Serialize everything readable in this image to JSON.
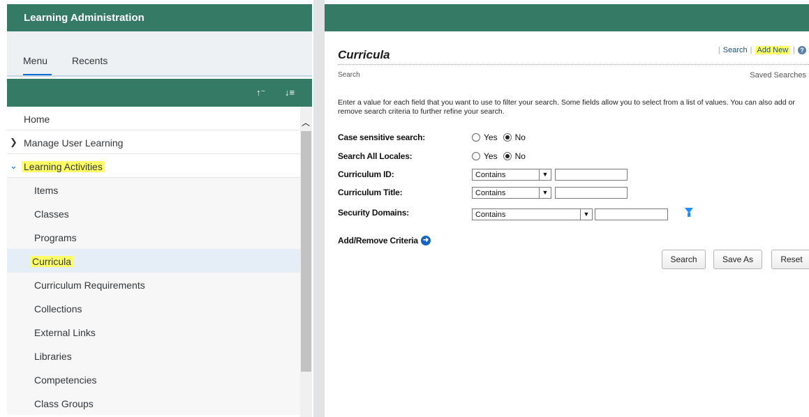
{
  "sidebar": {
    "title": "Learning Administration",
    "tabs": [
      {
        "label": "Menu",
        "selected": true
      },
      {
        "label": "Recents",
        "selected": false
      }
    ],
    "sort_asc_label": "↑⁻",
    "sort_desc_label": "↓≡",
    "items": [
      {
        "label": "Home",
        "level": 0
      },
      {
        "label": "Manage User Learning",
        "level": 0,
        "expanded": false
      },
      {
        "label": "Learning Activities",
        "level": 0,
        "expanded": true,
        "highlighted": true
      },
      {
        "label": "Items",
        "level": 1
      },
      {
        "label": "Classes",
        "level": 1
      },
      {
        "label": "Programs",
        "level": 1
      },
      {
        "label": "Curricula",
        "level": 1,
        "selected": true,
        "highlighted": true
      },
      {
        "label": "Curriculum Requirements",
        "level": 1
      },
      {
        "label": "Collections",
        "level": 1
      },
      {
        "label": "External Links",
        "level": 1
      },
      {
        "label": "Libraries",
        "level": 1
      },
      {
        "label": "Competencies",
        "level": 1
      },
      {
        "label": "Class Groups",
        "level": 1
      }
    ]
  },
  "main": {
    "title": "Curricula",
    "links": {
      "search": "Search",
      "add_new": "Add New"
    },
    "help_glyph": "?",
    "subtitle": "Search",
    "saved_searches": "Saved Searches",
    "instructions": "Enter a value for each field that you want to use to filter your search. Some fields allow you to select from a list of values. You can also add or remove search criteria to further refine your search.",
    "form": {
      "case_sensitive": {
        "label": "Case sensitive search:",
        "yes": "Yes",
        "no": "No",
        "value": "No"
      },
      "all_locales": {
        "label": "Search All Locales:",
        "yes": "Yes",
        "no": "No",
        "value": "No"
      },
      "curriculum_id": {
        "label": "Curriculum ID:",
        "operator": "Contains",
        "value": ""
      },
      "curriculum_title": {
        "label": "Curriculum Title:",
        "operator": "Contains",
        "value": ""
      },
      "security_domains": {
        "label": "Security Domains:",
        "operator": "Contains",
        "value": ""
      }
    },
    "add_remove_criteria": "Add/Remove Criteria",
    "buttons": {
      "search": "Search",
      "save_as": "Save As",
      "reset": "Reset"
    }
  },
  "colors": {
    "header_green": "#357a65",
    "highlight": "#ffff66",
    "accent_blue": "#0a6ed1"
  }
}
